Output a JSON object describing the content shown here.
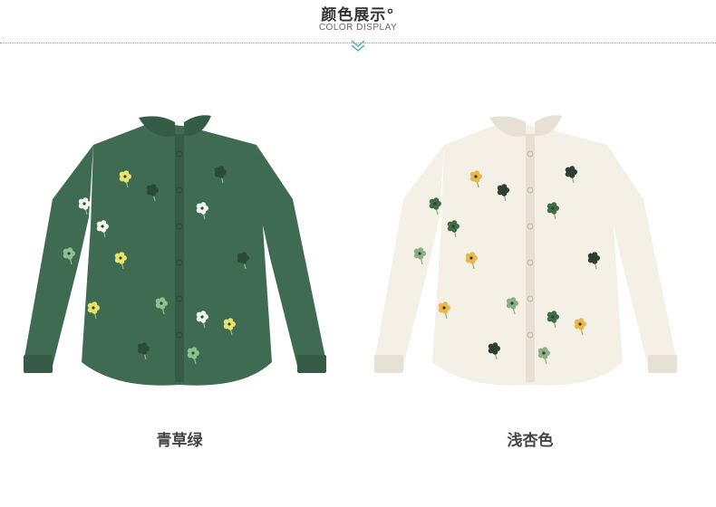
{
  "header": {
    "title": "颜色展示°",
    "subtitle": "COLOR DISPLAY"
  },
  "colors": {
    "accent": "#5fb3b3"
  },
  "products": [
    {
      "caption": "青草绿",
      "shirt_color": "#3f6b52",
      "shirt_shade": "#355c46",
      "embroidery": [
        "#e9e26c",
        "#f3f3f0",
        "#2c4a38",
        "#8cc08e"
      ]
    },
    {
      "caption": "浅杏色",
      "shirt_color": "#f4f0e6",
      "shirt_shade": "#e6e1d4",
      "embroidery": [
        "#e8b84a",
        "#3f6e45",
        "#2b3f34",
        "#8eb084"
      ]
    }
  ]
}
